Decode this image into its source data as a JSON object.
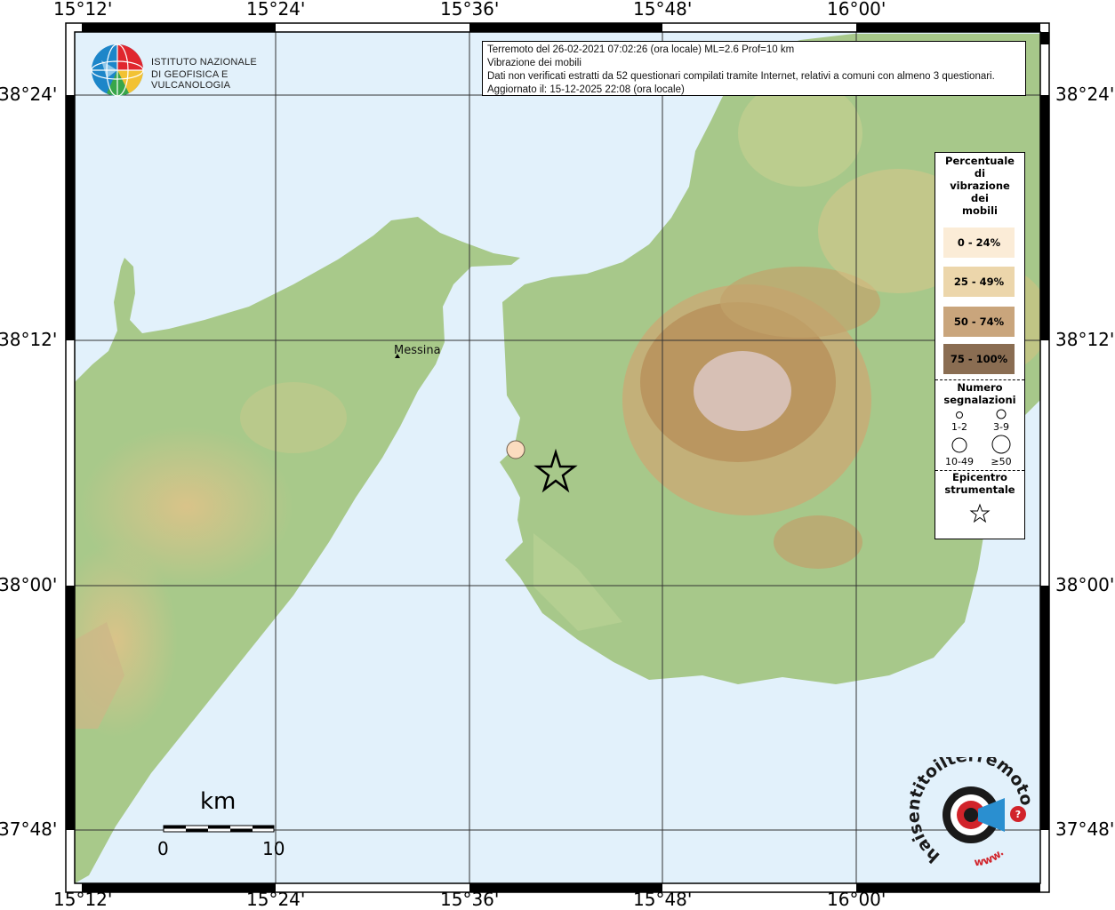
{
  "info": {
    "line1": "Terremoto del 26-02-2021 07:02:26 (ora locale) ML=2.6 Prof=10 km",
    "line2": "Vibrazione dei mobili",
    "line3": "Dati non verificati estratti da 52 questionari compilati tramite Internet, relativi a comuni con almeno 3 questionari.",
    "line4": "Aggiornato il: 15-12-2025 22:08 (ora locale)"
  },
  "logo": {
    "line1": "ISTITUTO NAZIONALE",
    "line2": "DI GEOFISICA E VULCANOLOGIA",
    "icon": "ingv-globe-icon"
  },
  "axes": {
    "top": [
      "15°12'",
      "15°24'",
      "15°36'",
      "15°48'",
      "16°00'"
    ],
    "bottom": [
      "15°12'",
      "15°24'",
      "15°36'",
      "15°48'",
      "16°00'"
    ],
    "left": [
      "38°24'",
      "38°12'",
      "38°00'",
      "37°48'"
    ],
    "right": [
      "38°24'",
      "38°12'",
      "38°00'",
      "37°48'"
    ]
  },
  "cities": [
    {
      "name": "Messina"
    }
  ],
  "scale": {
    "unit": "km",
    "min": "0",
    "max": "10"
  },
  "legend": {
    "title_lines": [
      "Percentuale",
      "di",
      "vibrazione",
      "dei",
      "mobili"
    ],
    "classes": [
      {
        "label": "0 - 24%",
        "color": "#fbecd7"
      },
      {
        "label": "25 - 49%",
        "color": "#ecd6ab"
      },
      {
        "label": "50 - 74%",
        "color": "#c9a57c"
      },
      {
        "label": "75 - 100%",
        "color": "#8a6d52"
      }
    ],
    "count_title_lines": [
      "Numero",
      "segnalazioni"
    ],
    "counts": [
      "1-2",
      "3-9",
      "10-49",
      "≥50"
    ],
    "epicenter_title_lines": [
      "Epicentro",
      "strumentale"
    ]
  },
  "observation": {
    "class": "0 - 24%",
    "count": "10-49"
  },
  "brand": {
    "text": "haisentitoilterremoto.it",
    "www": "www.",
    "accent": "#d1232a"
  }
}
